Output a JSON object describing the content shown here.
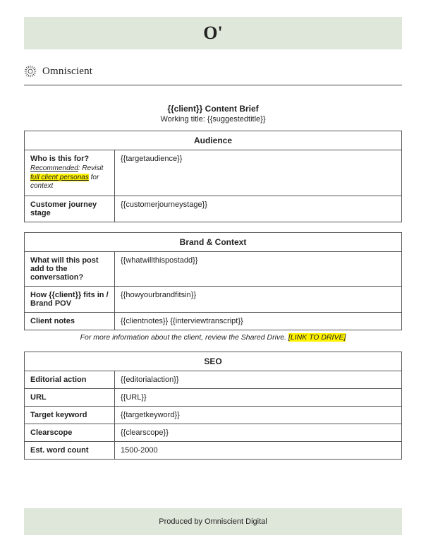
{
  "brand": {
    "logo_glyph": "O'",
    "name": "Omniscient"
  },
  "title": {
    "heading": "{{client}} Content Brief",
    "working_prefix": "Working title: ",
    "working_value": "{{suggestedtitle}}"
  },
  "sections": {
    "audience": {
      "header": "Audience",
      "who_label": "Who is this for?",
      "who_sub_prefix": "Recommended",
      "who_sub_mid": ": Revisit ",
      "who_sub_highlight": "full client personas",
      "who_sub_suffix": " for context",
      "who_value": "{{targetaudience}}",
      "journey_label": "Customer journey stage",
      "journey_value": "{{customerjourneystage}}"
    },
    "brandctx": {
      "header": "Brand & Context",
      "add_label": "What will this post add to the conversation?",
      "add_value": "{{whatwillthispostadd}}",
      "fit_label": "How {{client}} fits in / Brand POV",
      "fit_value": "{{howyourbrandfitsin}}",
      "notes_label": "Client notes",
      "notes_value": "{{clientnotes}} {{interviewtranscript}}",
      "footnote_text": "For more information about the client, review the Shared Drive. ",
      "footnote_link": "[LINK TO DRIVE]"
    },
    "seo": {
      "header": "SEO",
      "action_label": "Editorial action",
      "action_value": "{{editorialaction}}",
      "url_label": "URL",
      "url_value": "{{URL}}",
      "keyword_label": "Target keyword",
      "keyword_value": "{{targetkeyword}}",
      "clearscope_label": "Clearscope",
      "clearscope_value": "{{clearscope}}",
      "wc_label": "Est. word count",
      "wc_value": "1500-2000"
    }
  },
  "footer": "Produced by Omniscient Digital"
}
